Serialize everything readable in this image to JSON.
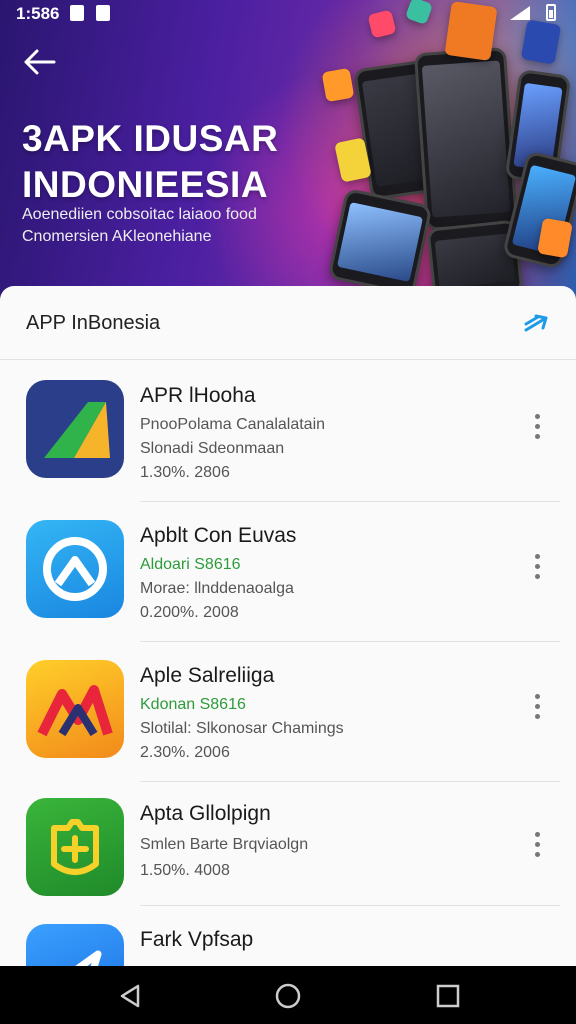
{
  "status_bar": {
    "time": "1:586"
  },
  "hero": {
    "title_line1": "3APK IDUSAR",
    "title_line2": "INDONIEESIA",
    "subtitle_line1": "Aoenediien cobsoitac laiaoo food",
    "subtitle_line2": "Cnomersien AKleonehiane"
  },
  "section": {
    "title": "APP InBonesia"
  },
  "apps": [
    {
      "name": "APR lHooha",
      "line1": "PnooPolama Canalalatain",
      "line2": "Slonadi Sdeonmaan",
      "line3": "1.30%. 2806",
      "icon": "triangle-app-icon",
      "color": "#2b3e8a"
    },
    {
      "name": "Apblt Con Euvas",
      "line1": "Aldoari S8616",
      "line2": "Morae: llnddenaoalga",
      "line3": "0.200%. 2008",
      "icon": "circle-a-app-icon",
      "color": "#1e9be8"
    },
    {
      "name": "Aple Salreliiga",
      "line1": "Kdonan S8616",
      "line2": "Slotilal: Slkonosar Chamings",
      "line3": "2.30%. 2006",
      "icon": "m-letter-app-icon",
      "color": "#f7b21d"
    },
    {
      "name": "Apta Gllolpign",
      "line1": "Smlen Barte Brqviaolgn",
      "line2": "1.50%. 4008",
      "icon": "shield-plus-app-icon",
      "color": "#2e9b2e"
    },
    {
      "name": "Fark Vpfsap",
      "icon": "arrow-app-icon",
      "color": "#1e7de8"
    }
  ],
  "colors": {
    "accent": "#1e9be8",
    "green_text": "#2e9b3a",
    "nav_bg": "#000000"
  }
}
